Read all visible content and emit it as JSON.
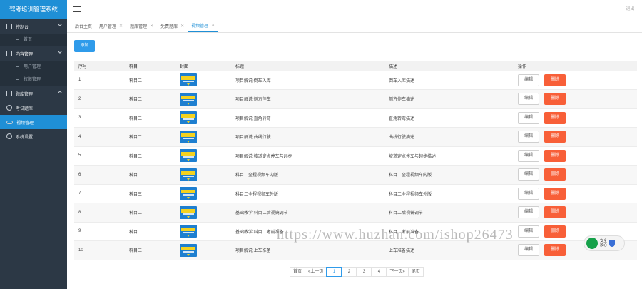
{
  "app": {
    "title": "驾考培训管理系统",
    "logout_label": "退出"
  },
  "sidebar": {
    "groups": [
      {
        "label": "控制台",
        "icon": "dashboard-icon"
      },
      {
        "label": "首页",
        "sub": true
      },
      {
        "label": "内容管理",
        "icon": "document-icon"
      },
      {
        "label": "用户管理",
        "sub": true
      },
      {
        "label": "权限管理",
        "sub": true
      },
      {
        "label": "题库管理",
        "icon": "layers-icon"
      },
      {
        "label": "考试题库",
        "icon": "gear-icon"
      },
      {
        "label": "视频管理",
        "icon": "link-icon",
        "active": true
      },
      {
        "label": "系统设置",
        "icon": "settings-icon"
      }
    ]
  },
  "tabs": [
    {
      "label": "后台主页",
      "closable": false
    },
    {
      "label": "用户管理",
      "closable": true
    },
    {
      "label": "题库管理",
      "closable": true
    },
    {
      "label": "免费题库",
      "closable": true
    },
    {
      "label": "视频管理",
      "closable": true,
      "active": true
    }
  ],
  "toolbar": {
    "add_label": "添加"
  },
  "table": {
    "headers": [
      "序号",
      "科目",
      "封面",
      "标题",
      "描述",
      "操作"
    ],
    "edit_label": "编辑",
    "delete_label": "删除",
    "rows": [
      {
        "no": "1",
        "subject": "科目二",
        "title": "项目解说 倒车入库",
        "desc": "倒车入库描述"
      },
      {
        "no": "2",
        "subject": "科目二",
        "title": "项目解说 侧方停车",
        "desc": "侧方停车描述"
      },
      {
        "no": "3",
        "subject": "科目二",
        "title": "项目解说 直角转弯",
        "desc": "直角转弯描述"
      },
      {
        "no": "4",
        "subject": "科目二",
        "title": "项目解说 曲线行驶",
        "desc": "曲线行驶描述"
      },
      {
        "no": "5",
        "subject": "科目二",
        "title": "项目解说 坡道定点停车与起步",
        "desc": "坡道定点停车与起步描述"
      },
      {
        "no": "6",
        "subject": "科目二",
        "title": "科目二全程视频车内版",
        "desc": "科目二全程视频车内版"
      },
      {
        "no": "7",
        "subject": "科目三",
        "title": "科目二全程视频车外版",
        "desc": "科目二全程视频车外版"
      },
      {
        "no": "8",
        "subject": "科目二",
        "title": "基础教学 科目二后视镜调节",
        "desc": "科目二后视镜调节"
      },
      {
        "no": "9",
        "subject": "科目二",
        "title": "基础教学 科目二考前准备",
        "desc": "科目二考前准备"
      },
      {
        "no": "10",
        "subject": "科目三",
        "title": "项目解说 上车准备",
        "desc": "上车准备描述"
      }
    ]
  },
  "pagination": {
    "first": "首页",
    "prev": "«上一页",
    "pages": [
      "1",
      "2",
      "3",
      "4"
    ],
    "current": "1",
    "next": "下一页»",
    "last": "尾页"
  },
  "watermark": {
    "text": "https://www.huzhan.com/ishop26473",
    "badge": "安全\n放心"
  }
}
